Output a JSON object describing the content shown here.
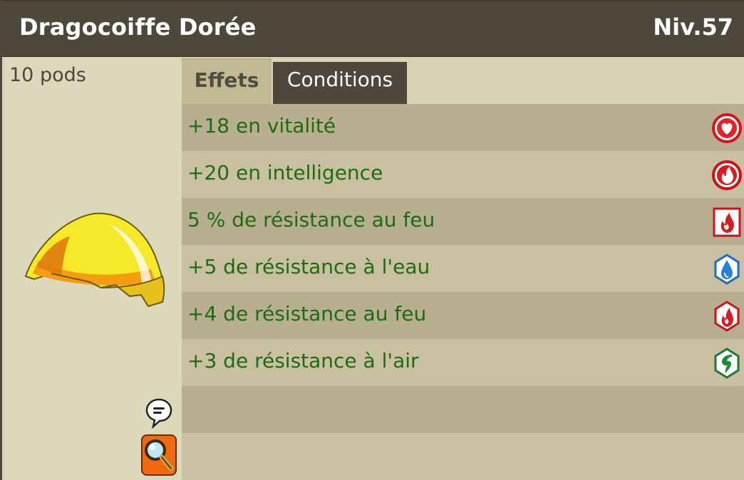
{
  "item": {
    "name": "Dragocoiffe Dorée",
    "level": "Niv.57",
    "weight": "10 pods"
  },
  "tabs": [
    {
      "label": "Effets",
      "active": true
    },
    {
      "label": "Conditions",
      "active": false
    }
  ],
  "effects": [
    {
      "text": "+18 en vitalité",
      "icon": "vitality-heart-icon"
    },
    {
      "text": "+20 en intelligence",
      "icon": "fire-intelligence-icon"
    },
    {
      "text": "5 % de résistance au feu",
      "icon": "fire-resistance-percent-icon"
    },
    {
      "text": "+5 de résistance à l'eau",
      "icon": "water-drop-icon"
    },
    {
      "text": "+4 de résistance au feu",
      "icon": "fire-resistance-icon"
    },
    {
      "text": "+3 de résistance à l'air",
      "icon": "air-icon"
    }
  ],
  "colors": {
    "header": "#4e473b",
    "effect_text": "#1f6a12",
    "panel": "#d8d3b4",
    "row_dark": "#b8ae90",
    "row_light": "#c8c0a0"
  }
}
